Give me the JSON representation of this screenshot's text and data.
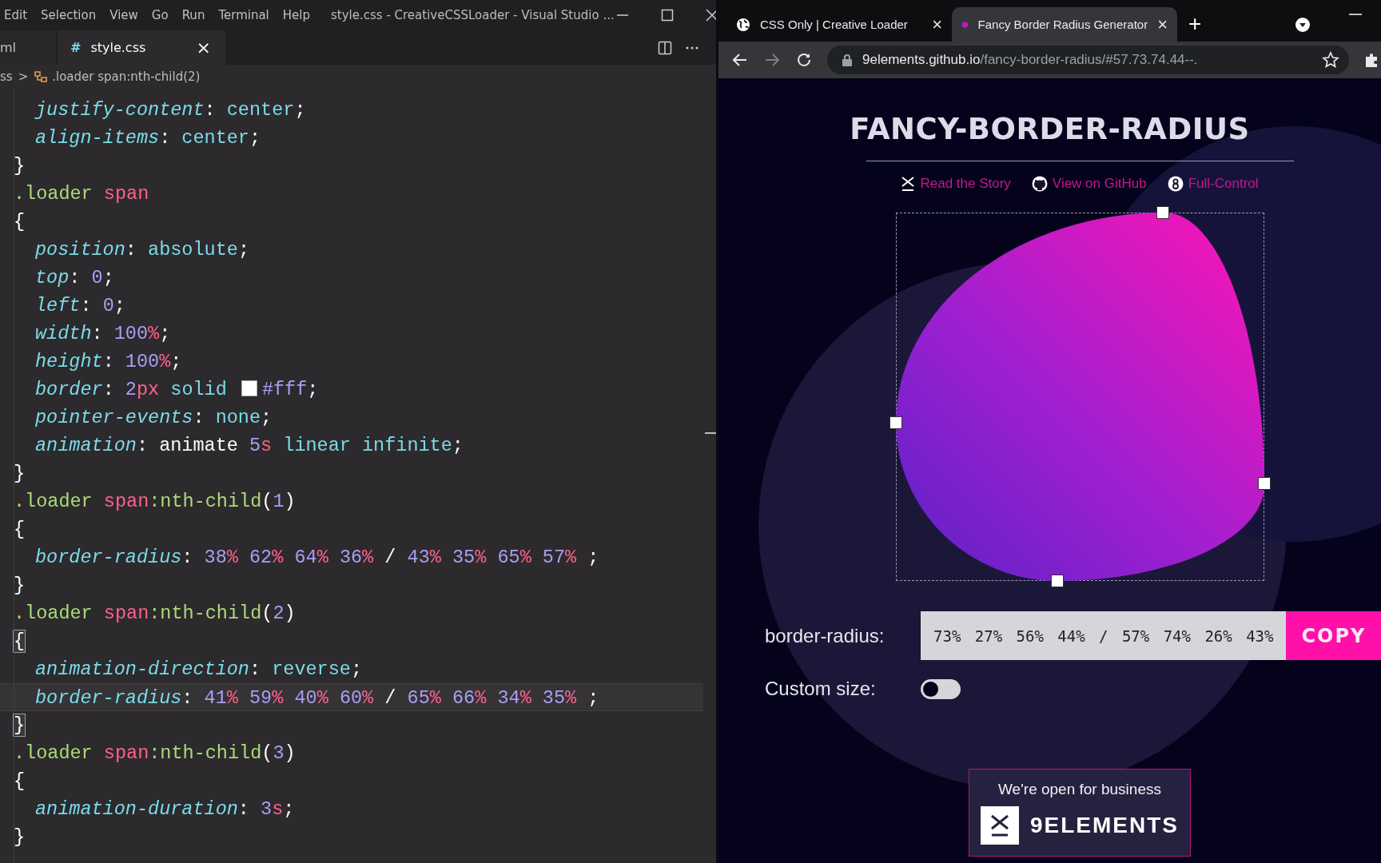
{
  "editor": {
    "menu": [
      "Edit",
      "Selection",
      "View",
      "Go",
      "Run",
      "Terminal",
      "Help"
    ],
    "window_title": "style.css - CreativeCSSLoader - Visual Studio ...",
    "tabs": [
      {
        "label": "ml",
        "selected": false
      },
      {
        "label": "style.css",
        "selected": true,
        "icon": "#",
        "close": "×"
      }
    ],
    "breadcrumb": {
      "folder": "ss",
      "separator": ">",
      "symbol": ".loader span:nth-child(2)"
    },
    "code_lines": [
      {
        "indent": true,
        "current": false,
        "bracket": false,
        "tokens": [
          {
            "kind": "prop",
            "text": "justify-content"
          },
          {
            "kind": "p",
            "text": ": "
          },
          {
            "kind": "kw",
            "text": "center"
          },
          {
            "kind": "p",
            "text": ";"
          }
        ]
      },
      {
        "indent": true,
        "current": false,
        "bracket": false,
        "tokens": [
          {
            "kind": "prop",
            "text": "align-items"
          },
          {
            "kind": "p",
            "text": ": "
          },
          {
            "kind": "kw",
            "text": "center"
          },
          {
            "kind": "p",
            "text": ";"
          }
        ]
      },
      {
        "indent": false,
        "current": false,
        "bracket": false,
        "tokens": [
          {
            "kind": "p",
            "text": "}"
          }
        ]
      },
      {
        "indent": false,
        "current": false,
        "bracket": false,
        "tokens": [
          {
            "kind": "sel",
            "text": ".loader "
          },
          {
            "kind": "tag",
            "text": "span"
          }
        ]
      },
      {
        "indent": false,
        "current": false,
        "bracket": false,
        "tokens": [
          {
            "kind": "p",
            "text": "{"
          }
        ]
      },
      {
        "indent": true,
        "current": false,
        "bracket": false,
        "tokens": [
          {
            "kind": "prop",
            "text": "position"
          },
          {
            "kind": "p",
            "text": ": "
          },
          {
            "kind": "kw",
            "text": "absolute"
          },
          {
            "kind": "p",
            "text": ";"
          }
        ]
      },
      {
        "indent": true,
        "current": false,
        "bracket": false,
        "tokens": [
          {
            "kind": "prop",
            "text": "top"
          },
          {
            "kind": "p",
            "text": ": "
          },
          {
            "kind": "num",
            "text": "0"
          },
          {
            "kind": "p",
            "text": ";"
          }
        ]
      },
      {
        "indent": true,
        "current": false,
        "bracket": false,
        "tokens": [
          {
            "kind": "prop",
            "text": "left"
          },
          {
            "kind": "p",
            "text": ": "
          },
          {
            "kind": "num",
            "text": "0"
          },
          {
            "kind": "p",
            "text": ";"
          }
        ]
      },
      {
        "indent": true,
        "current": false,
        "bracket": false,
        "tokens": [
          {
            "kind": "prop",
            "text": "width"
          },
          {
            "kind": "p",
            "text": ": "
          },
          {
            "kind": "num",
            "text": "100"
          },
          {
            "kind": "unit",
            "text": "%"
          },
          {
            "kind": "p",
            "text": ";"
          }
        ]
      },
      {
        "indent": true,
        "current": false,
        "bracket": false,
        "tokens": [
          {
            "kind": "prop",
            "text": "height"
          },
          {
            "kind": "p",
            "text": ": "
          },
          {
            "kind": "num",
            "text": "100"
          },
          {
            "kind": "unit",
            "text": "%"
          },
          {
            "kind": "p",
            "text": ";"
          }
        ]
      },
      {
        "indent": true,
        "current": false,
        "bracket": false,
        "tokens": [
          {
            "kind": "prop",
            "text": "border"
          },
          {
            "kind": "p",
            "text": ": "
          },
          {
            "kind": "num",
            "text": "2"
          },
          {
            "kind": "unit",
            "text": "px"
          },
          {
            "kind": "kw",
            "text": " solid "
          },
          {
            "kind": "swatch"
          },
          {
            "kind": "num",
            "text": "#fff"
          },
          {
            "kind": "p",
            "text": ";"
          }
        ]
      },
      {
        "indent": true,
        "current": false,
        "bracket": false,
        "tokens": [
          {
            "kind": "prop",
            "text": "pointer-events"
          },
          {
            "kind": "p",
            "text": ": "
          },
          {
            "kind": "kw",
            "text": "none"
          },
          {
            "kind": "p",
            "text": ";"
          }
        ]
      },
      {
        "indent": true,
        "current": false,
        "bracket": false,
        "tokens": [
          {
            "kind": "prop",
            "text": "animation"
          },
          {
            "kind": "p",
            "text": ": animate "
          },
          {
            "kind": "num",
            "text": "5"
          },
          {
            "kind": "unit",
            "text": "s"
          },
          {
            "kind": "kw",
            "text": " linear infinite"
          },
          {
            "kind": "p",
            "text": ";"
          }
        ]
      },
      {
        "indent": false,
        "current": false,
        "bracket": false,
        "tokens": [
          {
            "kind": "p",
            "text": "}"
          }
        ]
      },
      {
        "indent": false,
        "current": false,
        "bracket": false,
        "tokens": [
          {
            "kind": "sel",
            "text": ".loader "
          },
          {
            "kind": "tag",
            "text": "span"
          },
          {
            "kind": "sel",
            "text": ":nth-child"
          },
          {
            "kind": "p",
            "text": "("
          },
          {
            "kind": "num",
            "text": "1"
          },
          {
            "kind": "p",
            "text": ")"
          }
        ]
      },
      {
        "indent": false,
        "current": false,
        "bracket": false,
        "tokens": [
          {
            "kind": "p",
            "text": "{"
          }
        ]
      },
      {
        "indent": true,
        "current": false,
        "bracket": false,
        "tokens": [
          {
            "kind": "prop",
            "text": "border-radius"
          },
          {
            "kind": "p",
            "text": ": "
          },
          {
            "kind": "num",
            "text": "38"
          },
          {
            "kind": "unit",
            "text": "% "
          },
          {
            "kind": "num",
            "text": "62"
          },
          {
            "kind": "unit",
            "text": "% "
          },
          {
            "kind": "num",
            "text": "64"
          },
          {
            "kind": "unit",
            "text": "% "
          },
          {
            "kind": "num",
            "text": "36"
          },
          {
            "kind": "unit",
            "text": "% "
          },
          {
            "kind": "p",
            "text": "/ "
          },
          {
            "kind": "num",
            "text": "43"
          },
          {
            "kind": "unit",
            "text": "% "
          },
          {
            "kind": "num",
            "text": "35"
          },
          {
            "kind": "unit",
            "text": "% "
          },
          {
            "kind": "num",
            "text": "65"
          },
          {
            "kind": "unit",
            "text": "% "
          },
          {
            "kind": "num",
            "text": "57"
          },
          {
            "kind": "unit",
            "text": "% "
          },
          {
            "kind": "p",
            "text": ";"
          }
        ]
      },
      {
        "indent": false,
        "current": false,
        "bracket": false,
        "tokens": [
          {
            "kind": "p",
            "text": "}"
          }
        ]
      },
      {
        "indent": false,
        "current": false,
        "bracket": false,
        "tokens": [
          {
            "kind": "sel",
            "text": ".loader "
          },
          {
            "kind": "tag",
            "text": "span"
          },
          {
            "kind": "sel",
            "text": ":nth-child"
          },
          {
            "kind": "p",
            "text": "("
          },
          {
            "kind": "num",
            "text": "2"
          },
          {
            "kind": "p",
            "text": ")"
          }
        ]
      },
      {
        "indent": false,
        "current": false,
        "bracket": true,
        "tokens": [
          {
            "kind": "p",
            "text": "{"
          }
        ]
      },
      {
        "indent": true,
        "current": false,
        "bracket": false,
        "tokens": [
          {
            "kind": "prop",
            "text": "animation-direction"
          },
          {
            "kind": "p",
            "text": ": "
          },
          {
            "kind": "kw",
            "text": "reverse"
          },
          {
            "kind": "p",
            "text": ";"
          }
        ]
      },
      {
        "indent": true,
        "current": true,
        "bracket": false,
        "tokens": [
          {
            "kind": "prop",
            "text": "border-radius"
          },
          {
            "kind": "p",
            "text": ": "
          },
          {
            "kind": "num",
            "text": "41"
          },
          {
            "kind": "unit",
            "text": "% "
          },
          {
            "kind": "num",
            "text": "59"
          },
          {
            "kind": "unit",
            "text": "% "
          },
          {
            "kind": "num",
            "text": "40"
          },
          {
            "kind": "unit",
            "text": "% "
          },
          {
            "kind": "num",
            "text": "60"
          },
          {
            "kind": "unit",
            "text": "% "
          },
          {
            "kind": "p",
            "text": "/ "
          },
          {
            "kind": "num",
            "text": "65"
          },
          {
            "kind": "unit",
            "text": "% "
          },
          {
            "kind": "num",
            "text": "66"
          },
          {
            "kind": "unit",
            "text": "% "
          },
          {
            "kind": "num",
            "text": "34"
          },
          {
            "kind": "unit",
            "text": "% "
          },
          {
            "kind": "num",
            "text": "35"
          },
          {
            "kind": "unit",
            "text": "% "
          },
          {
            "kind": "p",
            "text": ";"
          }
        ]
      },
      {
        "indent": false,
        "current": false,
        "bracket": true,
        "tokens": [
          {
            "kind": "p",
            "text": "}"
          }
        ]
      },
      {
        "indent": false,
        "current": false,
        "bracket": false,
        "tokens": [
          {
            "kind": "sel",
            "text": ".loader "
          },
          {
            "kind": "tag",
            "text": "span"
          },
          {
            "kind": "sel",
            "text": ":nth-child"
          },
          {
            "kind": "p",
            "text": "("
          },
          {
            "kind": "num",
            "text": "3"
          },
          {
            "kind": "p",
            "text": ")"
          }
        ]
      },
      {
        "indent": false,
        "current": false,
        "bracket": false,
        "tokens": [
          {
            "kind": "p",
            "text": "{"
          }
        ]
      },
      {
        "indent": true,
        "current": false,
        "bracket": false,
        "tokens": [
          {
            "kind": "prop",
            "text": "animation-duration"
          },
          {
            "kind": "p",
            "text": ": "
          },
          {
            "kind": "num",
            "text": "3"
          },
          {
            "kind": "unit",
            "text": "s"
          },
          {
            "kind": "p",
            "text": ";"
          }
        ]
      },
      {
        "indent": false,
        "current": false,
        "bracket": false,
        "tokens": [
          {
            "kind": "p",
            "text": "}"
          }
        ]
      }
    ]
  },
  "browser": {
    "tabs": [
      {
        "title": "CSS Only | Creative Loader",
        "selected": false,
        "close": "×"
      },
      {
        "title": "Fancy Border Radius Generator",
        "selected": true,
        "close": "×"
      }
    ],
    "new_tab": "+",
    "url_host": "9elements.github.io",
    "url_path": "/fancy-border-radius/#57.73.74.44--.",
    "page": {
      "title": "FANCY-BORDER-RADIUS",
      "links": [
        "Read the Story",
        "View on GitHub",
        "Full-Control"
      ],
      "border_radius_label": "border-radius:",
      "border_radius_value": "73% 27% 56% 44% / 57% 74% 26% 43%",
      "copy_button": "COPY",
      "custom_size_label": "Custom size:",
      "custom_size_on": false,
      "ad_text": "We're open for business",
      "ad_brand": "9ELEMENTS"
    }
  }
}
